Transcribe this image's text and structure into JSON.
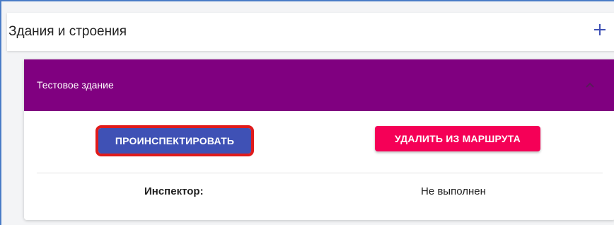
{
  "panel": {
    "title": "Здания и строения",
    "add_icon": "plus-icon",
    "accent_color": "#3f51b5"
  },
  "building_card": {
    "title": "Тестовое здание",
    "header_color": "#800080",
    "collapse_icon": "chevron-up-icon",
    "inspect_button_label": "ПРОИНСПЕКТИРОВАТЬ",
    "inspect_button_color": "#3f51b5",
    "delete_button_label": "УДАЛИТЬ ИЗ МАРШРУТА",
    "delete_button_color": "#f50057",
    "highlight_color": "#e01b1b",
    "inspector_label": "Инспектор:",
    "inspector_value": "Не выполнен"
  }
}
